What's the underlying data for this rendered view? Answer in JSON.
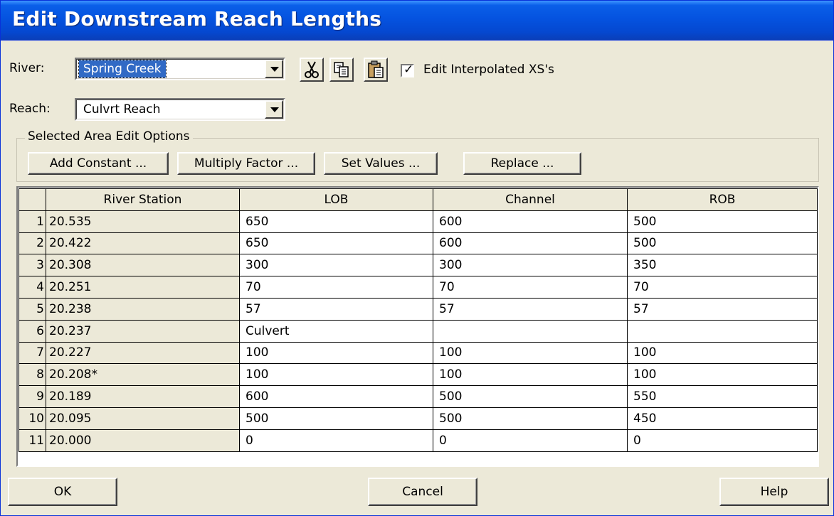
{
  "window": {
    "title": "Edit Downstream Reach Lengths"
  },
  "river": {
    "label": "River:",
    "value": "Spring Creek"
  },
  "reach": {
    "label": "Reach:",
    "value": "Culvrt Reach"
  },
  "toolbar": {
    "cut_icon": "scissors-icon",
    "copy_icon": "copy-icon",
    "paste_icon": "paste-icon",
    "edit_interpolated": {
      "label": "Edit Interpolated XS's",
      "checked": true
    }
  },
  "edit_options": {
    "title": "Selected Area Edit Options",
    "add_constant": "Add Constant ...",
    "multiply_factor": "Multiply Factor ...",
    "set_values": "Set Values ...",
    "replace": "Replace ..."
  },
  "table": {
    "columns": [
      "River Station",
      "LOB",
      "Channel",
      "ROB"
    ],
    "rows": [
      {
        "num": "1",
        "station": "20.535",
        "lob": "650",
        "channel": "600",
        "rob": "500"
      },
      {
        "num": "2",
        "station": "20.422",
        "lob": "650",
        "channel": "600",
        "rob": "500"
      },
      {
        "num": "3",
        "station": "20.308",
        "lob": "300",
        "channel": "300",
        "rob": "350"
      },
      {
        "num": "4",
        "station": "20.251",
        "lob": "70",
        "channel": "70",
        "rob": "70"
      },
      {
        "num": "5",
        "station": "20.238",
        "lob": "57",
        "channel": "57",
        "rob": "57"
      },
      {
        "num": "6",
        "station": "20.237",
        "lob": "Culvert",
        "channel": "",
        "rob": ""
      },
      {
        "num": "7",
        "station": "20.227",
        "lob": "100",
        "channel": "100",
        "rob": "100"
      },
      {
        "num": "8",
        "station": "20.208*",
        "lob": "100",
        "channel": "100",
        "rob": "100"
      },
      {
        "num": "9",
        "station": "20.189",
        "lob": "600",
        "channel": "500",
        "rob": "550"
      },
      {
        "num": "10",
        "station": "20.095",
        "lob": "500",
        "channel": "500",
        "rob": "450"
      },
      {
        "num": "11",
        "station": "20.000",
        "lob": "0",
        "channel": "0",
        "rob": "0"
      }
    ]
  },
  "buttons": {
    "ok": "OK",
    "cancel": "Cancel",
    "help": "Help"
  }
}
